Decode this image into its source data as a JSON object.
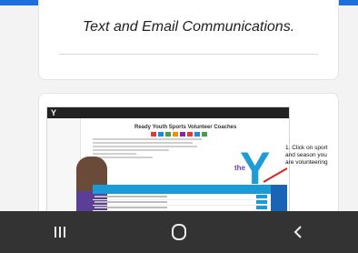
{
  "card1": {
    "title": "Text and Email Communications."
  },
  "card2": {
    "image_title": "Ready Youth Sports Volunteer Coaches",
    "note": "1. Click on sport and season you are volunteering",
    "ymca_mark": "the",
    "ymca_letter": "Y"
  },
  "navbar": {
    "recent_icon": "|||",
    "home_icon": "○",
    "back_icon": "<"
  },
  "colors": {
    "accent": "#1e6fd9",
    "ymca_blue": "#1a9bd7",
    "nav_bg": "#333333"
  }
}
